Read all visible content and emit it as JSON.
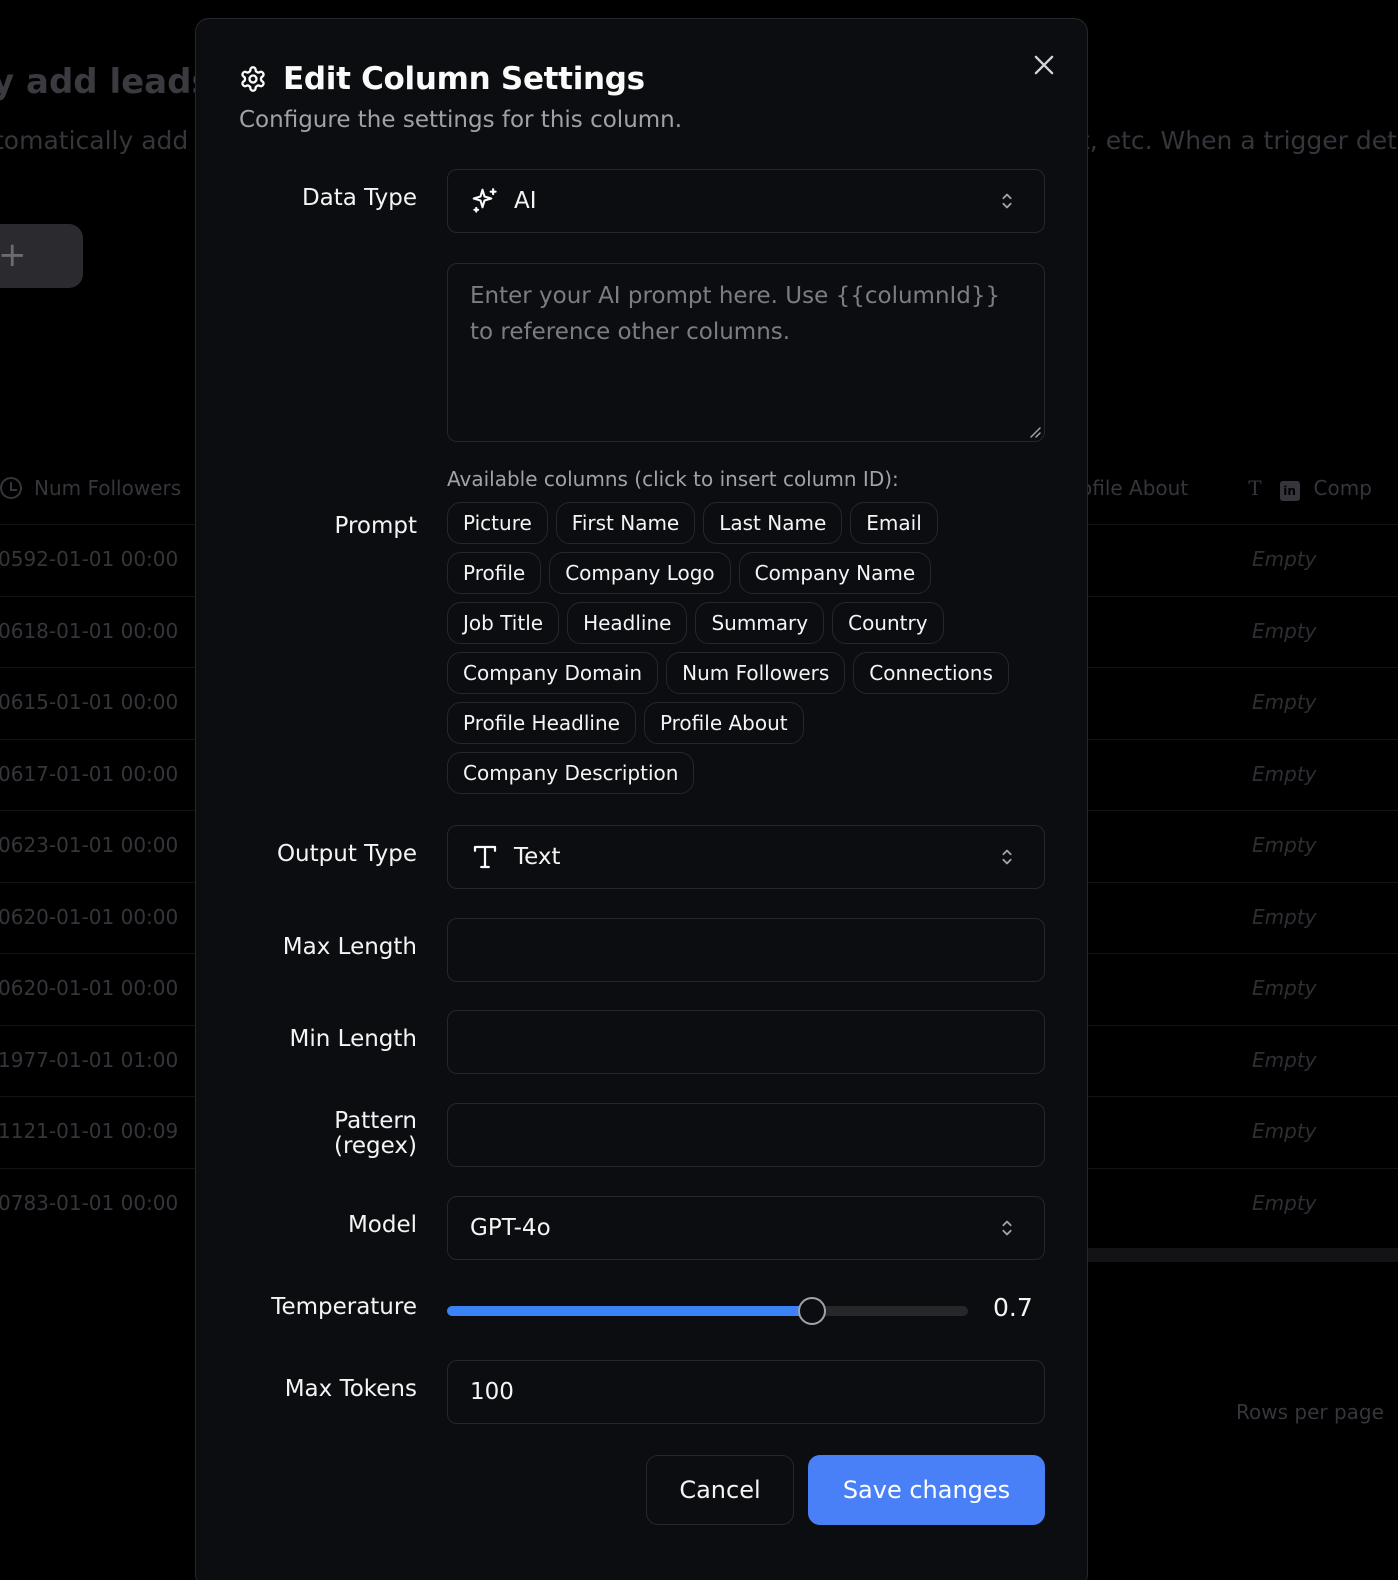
{
  "background": {
    "title": "y add leads w",
    "description_left": "tomatically add",
    "description_right": "t, etc. When a trigger det",
    "add_button_label": "+",
    "column_left": "Num Followers",
    "column_right_partial": "ofile About",
    "column_right_next": "Comp",
    "rows": [
      {
        "date": "0592-01-01 00:00",
        "value": "Empty"
      },
      {
        "date": "0618-01-01 00:00",
        "value": "Empty"
      },
      {
        "date": "0615-01-01 00:00",
        "value": "Empty"
      },
      {
        "date": "0617-01-01 00:00",
        "value": "Empty"
      },
      {
        "date": "0623-01-01 00:00",
        "value": "Empty"
      },
      {
        "date": "0620-01-01 00:00",
        "value": "Empty"
      },
      {
        "date": "0620-01-01 00:00",
        "value": "Empty"
      },
      {
        "date": "1977-01-01 01:00",
        "value": "Empty"
      },
      {
        "date": "1121-01-01 00:09",
        "value": "Empty"
      },
      {
        "date": "0783-01-01 00:00",
        "value": "Empty"
      }
    ],
    "rows_per_page": "Rows per page"
  },
  "modal": {
    "title": "Edit Column Settings",
    "subtitle": "Configure the settings for this column.",
    "data_type": {
      "label": "Data Type",
      "value": "AI",
      "icon": "sparkles-icon"
    },
    "prompt": {
      "label": "Prompt",
      "placeholder": "Enter your AI prompt here. Use {{columnId}} to reference other columns.",
      "value": "",
      "available_label": "Available columns (click to insert column ID):",
      "columns": [
        "Picture",
        "First Name",
        "Last Name",
        "Email",
        "Profile",
        "Company Logo",
        "Company Name",
        "Job Title",
        "Headline",
        "Summary",
        "Country",
        "Company Domain",
        "Num Followers",
        "Connections",
        "Profile Headline",
        "Profile About",
        "Company Description"
      ]
    },
    "output_type": {
      "label": "Output Type",
      "value": "Text",
      "icon": "text-type-icon"
    },
    "max_length": {
      "label": "Max Length",
      "value": ""
    },
    "min_length": {
      "label": "Min Length",
      "value": ""
    },
    "pattern": {
      "label_line1": "Pattern",
      "label_line2": "(regex)",
      "value": ""
    },
    "model": {
      "label": "Model",
      "value": "GPT-4o"
    },
    "temperature": {
      "label": "Temperature",
      "value": 0.7,
      "display": "0.7",
      "min": 0,
      "max": 1
    },
    "max_tokens": {
      "label": "Max Tokens",
      "value": "100"
    },
    "cancel_label": "Cancel",
    "save_label": "Save changes"
  },
  "colors": {
    "accent": "#4a80f7",
    "slider_fill": "#3b82f6",
    "modal_bg": "#0c0d10",
    "border": "#27272a"
  }
}
